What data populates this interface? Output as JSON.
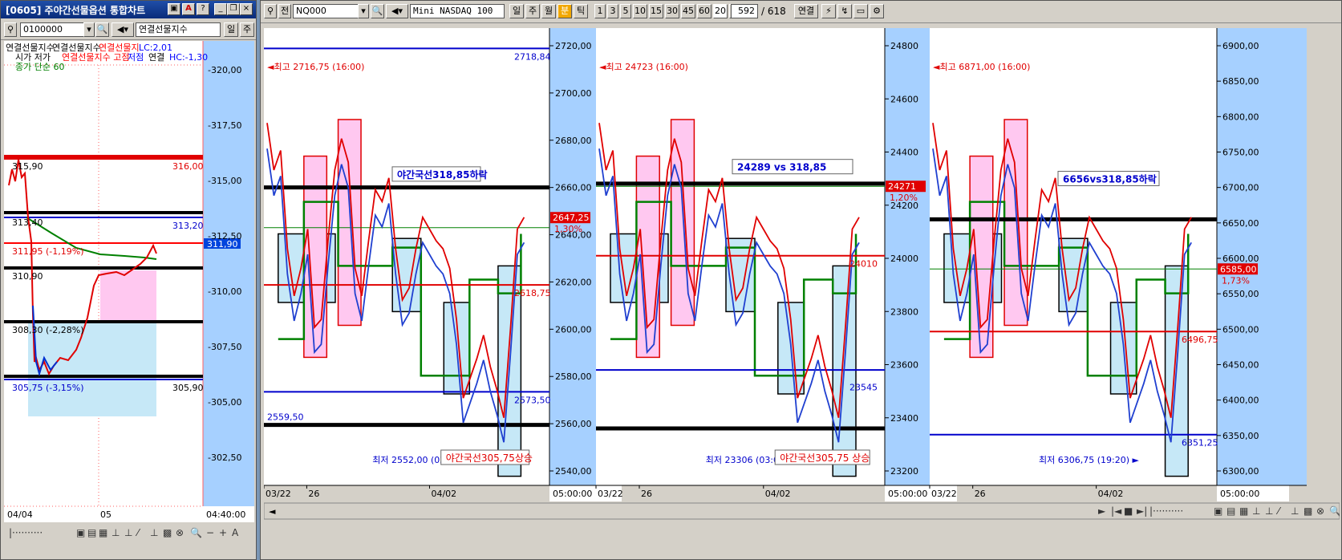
{
  "left_window": {
    "title": "[0605] 주야간선물옵션 통합차트",
    "code": "0100000",
    "symbol_name": "연결선물지수",
    "btn_day": "일",
    "btn_week": "주",
    "legend_line1": [
      {
        "text": "연결선물지수",
        "color": "#000000"
      },
      {
        "text": "연결선물지수",
        "color": "#000000"
      },
      {
        "text": "연결선물지",
        "color": "#ff0000"
      },
      {
        "text": "LC:2,01",
        "color": "#0000ff"
      }
    ],
    "legend_line2": [
      {
        "text": "시가  저가",
        "color": "#000000"
      },
      {
        "text": "연결선물지수 고점",
        "color": "#ff0000"
      },
      {
        "text": "저점",
        "color": "#0000ff"
      },
      {
        "text": "연결",
        "color": "#000000"
      },
      {
        "text": "HC:-1,30",
        "color": "#0000ff"
      }
    ],
    "legend_line3": "종가 단순 60",
    "y_ticks": [
      "320,00",
      "317,50",
      "315,00",
      "312,50",
      "310,00",
      "307,50",
      "305,00",
      "302,50"
    ],
    "x_ticks": [
      "04/04",
      "05"
    ],
    "time_label": "04:40:00",
    "labels": {
      "l1": "315,90",
      "l2": "316,00",
      "l3": "313,40",
      "l4": "313,20",
      "l5": "311,90",
      "l6": "311,95 (-1,19%)",
      "l7": "310,90",
      "l8": "308,30 (-2,28%)",
      "l9": "305,75 (-3,15%)",
      "l10": "305,90"
    }
  },
  "right_window": {
    "code": "NQ000",
    "symbol_name": "Mini NASDAQ 100",
    "period_buttons": [
      "일",
      "주",
      "월",
      "분",
      "틱"
    ],
    "interval_buttons": [
      "1",
      "3",
      "5",
      "10",
      "15",
      "30",
      "45",
      "60",
      "20"
    ],
    "count": "592",
    "total": "/ 618",
    "link_label": "연결",
    "panels": [
      {
        "y_ticks": [
          "2720,00",
          "2700,00",
          "2680,00",
          "2660,00",
          "2640,00",
          "2620,00",
          "2600,00",
          "2580,00",
          "2560,00",
          "2540,00"
        ],
        "x_ticks": [
          "03/22",
          "26",
          "04/02"
        ],
        "time_label": "05:00:00",
        "high_label": "최고 2716,75 (16:00)",
        "low_label": "최저 2552,00 (03:00)",
        "annotation_top": "야간국선318,85하락",
        "annotation_bottom": "야간국선305,75상승",
        "price_badge": "2647,25",
        "change_pct": "1,30%",
        "level_labels": [
          "2718,84",
          "2618,75",
          "2573,50",
          "2559,50"
        ]
      },
      {
        "y_ticks": [
          "24800",
          "24600",
          "24400",
          "24200",
          "24000",
          "23800",
          "23600",
          "23400",
          "23200"
        ],
        "x_ticks": [
          "03/22",
          "26",
          "04/02"
        ],
        "time_label": "05:00:00",
        "high_label": "최고 24723 (16:00)",
        "low_label": "최저 23306 (03:00)",
        "annotation_top": "24289  vs  318,85",
        "annotation_bottom": "야간국선305,75 상승",
        "price_badge": "24271",
        "change_pct": "1,20%",
        "level_labels": [
          "24010",
          "23545"
        ]
      },
      {
        "y_ticks": [
          "6900,00",
          "6850,00",
          "6800,00",
          "6750,00",
          "6700,00",
          "6650,00",
          "6600,00",
          "6550,00",
          "6500,00",
          "6450,00",
          "6400,00",
          "6350,00",
          "6300,00"
        ],
        "x_ticks": [
          "03/22",
          "26",
          "04/02"
        ],
        "time_label": "05:00:00",
        "high_label": "최고 6871,00 (16:00)",
        "low_label": "최저 6306,75 (19:20)",
        "annotation_top": "6656vs318,85하락",
        "price_badge": "6585,00",
        "change_pct": "1,73%",
        "level_labels": [
          "6496,75",
          "6351,25"
        ]
      }
    ]
  }
}
